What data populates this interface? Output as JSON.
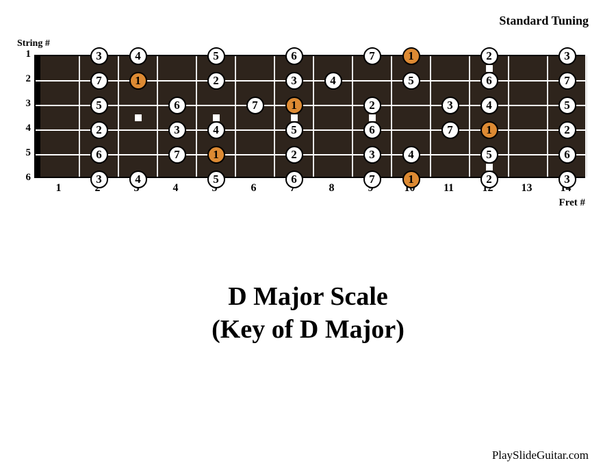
{
  "labels": {
    "tuning": "Standard Tuning",
    "string_axis": "String #",
    "fret_axis": "Fret #",
    "title_line1": "D Major Scale",
    "title_line2": "(Key of D Major)",
    "credit": "PlaySlideGuitar.com"
  },
  "strings": [
    1,
    2,
    3,
    4,
    5,
    6
  ],
  "frets": [
    1,
    2,
    3,
    4,
    5,
    6,
    7,
    8,
    9,
    10,
    11,
    12,
    13,
    14
  ],
  "inlays_single": [
    3,
    5,
    7,
    9
  ],
  "inlays_double": [
    12
  ],
  "chart_data": {
    "type": "fretboard-diagram",
    "tuning": "Standard (E A D G B E)",
    "key": "D Major",
    "scale": "Major",
    "root_degree": 1,
    "num_strings": 6,
    "num_frets": 14,
    "notes": [
      {
        "string": 1,
        "fret": 2,
        "degree": 3,
        "root": false
      },
      {
        "string": 1,
        "fret": 3,
        "degree": 4,
        "root": false
      },
      {
        "string": 1,
        "fret": 5,
        "degree": 5,
        "root": false
      },
      {
        "string": 1,
        "fret": 7,
        "degree": 6,
        "root": false
      },
      {
        "string": 1,
        "fret": 9,
        "degree": 7,
        "root": false
      },
      {
        "string": 1,
        "fret": 10,
        "degree": 1,
        "root": true
      },
      {
        "string": 1,
        "fret": 12,
        "degree": 2,
        "root": false
      },
      {
        "string": 1,
        "fret": 14,
        "degree": 3,
        "root": false
      },
      {
        "string": 2,
        "fret": 2,
        "degree": 7,
        "root": false
      },
      {
        "string": 2,
        "fret": 3,
        "degree": 1,
        "root": true
      },
      {
        "string": 2,
        "fret": 5,
        "degree": 2,
        "root": false
      },
      {
        "string": 2,
        "fret": 7,
        "degree": 3,
        "root": false
      },
      {
        "string": 2,
        "fret": 8,
        "degree": 4,
        "root": false
      },
      {
        "string": 2,
        "fret": 10,
        "degree": 5,
        "root": false
      },
      {
        "string": 2,
        "fret": 12,
        "degree": 6,
        "root": false
      },
      {
        "string": 2,
        "fret": 14,
        "degree": 7,
        "root": false
      },
      {
        "string": 3,
        "fret": 2,
        "degree": 5,
        "root": false
      },
      {
        "string": 3,
        "fret": 4,
        "degree": 6,
        "root": false
      },
      {
        "string": 3,
        "fret": 6,
        "degree": 7,
        "root": false
      },
      {
        "string": 3,
        "fret": 7,
        "degree": 1,
        "root": true
      },
      {
        "string": 3,
        "fret": 9,
        "degree": 2,
        "root": false
      },
      {
        "string": 3,
        "fret": 11,
        "degree": 3,
        "root": false
      },
      {
        "string": 3,
        "fret": 12,
        "degree": 4,
        "root": false
      },
      {
        "string": 3,
        "fret": 14,
        "degree": 5,
        "root": false
      },
      {
        "string": 4,
        "fret": 2,
        "degree": 2,
        "root": false
      },
      {
        "string": 4,
        "fret": 4,
        "degree": 3,
        "root": false
      },
      {
        "string": 4,
        "fret": 5,
        "degree": 4,
        "root": false
      },
      {
        "string": 4,
        "fret": 7,
        "degree": 5,
        "root": false
      },
      {
        "string": 4,
        "fret": 9,
        "degree": 6,
        "root": false
      },
      {
        "string": 4,
        "fret": 11,
        "degree": 7,
        "root": false
      },
      {
        "string": 4,
        "fret": 12,
        "degree": 1,
        "root": true
      },
      {
        "string": 4,
        "fret": 14,
        "degree": 2,
        "root": false
      },
      {
        "string": 5,
        "fret": 2,
        "degree": 6,
        "root": false
      },
      {
        "string": 5,
        "fret": 4,
        "degree": 7,
        "root": false
      },
      {
        "string": 5,
        "fret": 5,
        "degree": 1,
        "root": true
      },
      {
        "string": 5,
        "fret": 7,
        "degree": 2,
        "root": false
      },
      {
        "string": 5,
        "fret": 9,
        "degree": 3,
        "root": false
      },
      {
        "string": 5,
        "fret": 10,
        "degree": 4,
        "root": false
      },
      {
        "string": 5,
        "fret": 12,
        "degree": 5,
        "root": false
      },
      {
        "string": 5,
        "fret": 14,
        "degree": 6,
        "root": false
      },
      {
        "string": 6,
        "fret": 2,
        "degree": 3,
        "root": false
      },
      {
        "string": 6,
        "fret": 3,
        "degree": 4,
        "root": false
      },
      {
        "string": 6,
        "fret": 5,
        "degree": 5,
        "root": false
      },
      {
        "string": 6,
        "fret": 7,
        "degree": 6,
        "root": false
      },
      {
        "string": 6,
        "fret": 9,
        "degree": 7,
        "root": false
      },
      {
        "string": 6,
        "fret": 10,
        "degree": 1,
        "root": true
      },
      {
        "string": 6,
        "fret": 12,
        "degree": 2,
        "root": false
      },
      {
        "string": 6,
        "fret": 14,
        "degree": 3,
        "root": false
      }
    ]
  }
}
